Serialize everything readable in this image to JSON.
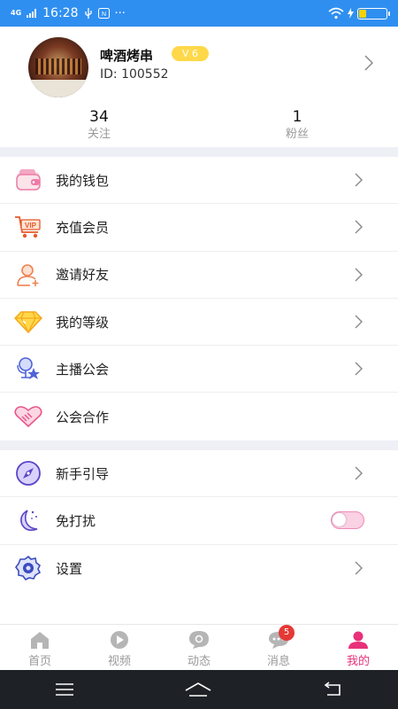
{
  "status_bar": {
    "network": "4G",
    "time": "16:28",
    "more": "···",
    "battery_percent": 25
  },
  "profile": {
    "username": "啤酒烤串",
    "level": "V 6",
    "user_id": "ID: 100552",
    "following_count": "34",
    "following_label": "关注",
    "fans_count": "1",
    "fans_label": "粉丝"
  },
  "menu_group_1": [
    {
      "label": "我的钱包",
      "icon": "wallet-icon"
    },
    {
      "label": "充值会员",
      "icon": "vip-cart-icon"
    },
    {
      "label": "邀请好友",
      "icon": "invite-user-icon"
    },
    {
      "label": "我的等级",
      "icon": "diamond-icon"
    },
    {
      "label": "主播公会",
      "icon": "anchor-mic-icon"
    },
    {
      "label": "公会合作",
      "icon": "handshake-icon"
    }
  ],
  "menu_group_2": [
    {
      "label": "新手引导",
      "icon": "compass-icon"
    },
    {
      "label": "免打扰",
      "icon": "moon-icon",
      "toggle_on": false
    },
    {
      "label": "设置",
      "icon": "settings-icon"
    }
  ],
  "tabbar": {
    "tabs": [
      {
        "label": "首页",
        "icon": "home-icon"
      },
      {
        "label": "视频",
        "icon": "video-play-icon"
      },
      {
        "label": "动态",
        "icon": "moments-icon"
      },
      {
        "label": "消息",
        "icon": "message-icon",
        "badge": "5"
      },
      {
        "label": "我的",
        "icon": "profile-icon",
        "active": true
      }
    ]
  },
  "colors": {
    "status_bar": "#2f8ff0",
    "accent_pink": "#e8317a",
    "level_badge": "#ffd84a"
  }
}
